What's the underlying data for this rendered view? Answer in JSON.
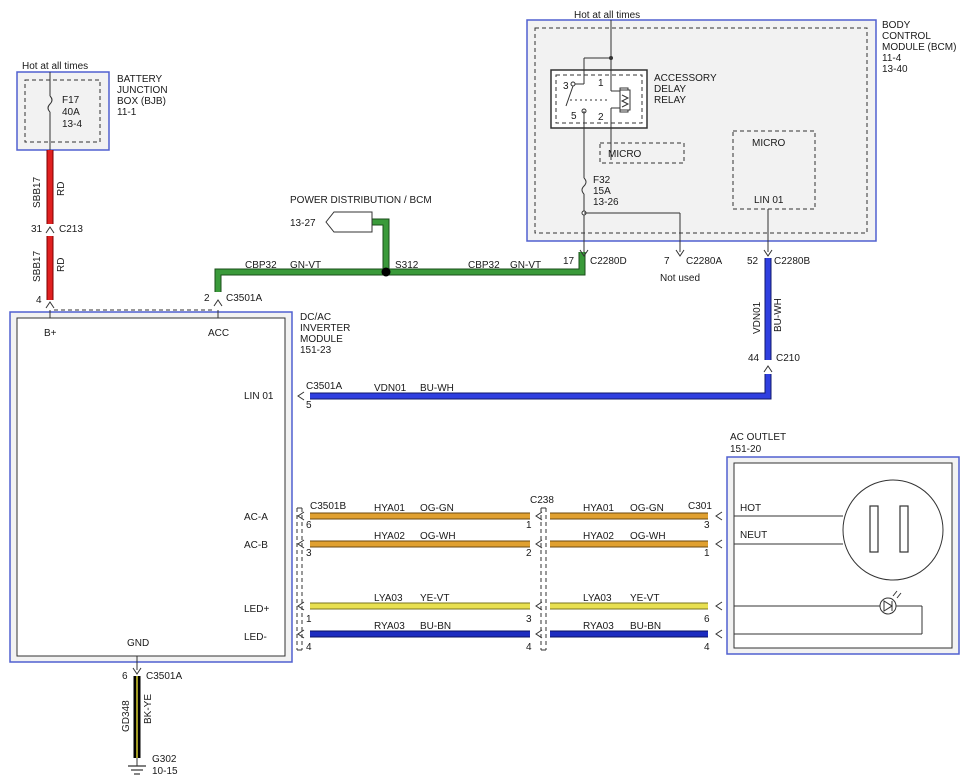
{
  "colors": {
    "red": "#e02020",
    "green": "#3a9a3a",
    "blue": "#2f3fe0",
    "orange": "#e0a030",
    "yellow": "#e8e050",
    "navy": "#1c2cc0",
    "black_yellow": "#2a2a10",
    "module_border": "#5060d0"
  },
  "hot_at_all_times": "Hot at all times",
  "bjb": {
    "name": "BATTERY JUNCTION BOX (BJB)",
    "line1": "BATTERY",
    "line2": "JUNCTION",
    "line3": "BOX (BJB)",
    "ref": "11-1",
    "fuse_id": "F17",
    "fuse_rating": "40A",
    "fuse_ref": "13-4"
  },
  "sbb17_wire": {
    "circuit": "SBB17",
    "color": "RD"
  },
  "c213": {
    "name": "C213",
    "pin": "31"
  },
  "inverter": {
    "line1": "DC/AC",
    "line2": "INVERTER",
    "line3": "MODULE",
    "ref": "151-23",
    "pin_bplus": "B+",
    "pin_acc": "ACC",
    "pin_lin": "LIN 01",
    "pin_aca": "AC-A",
    "pin_acb": "AC-B",
    "pin_ledp": "LED+",
    "pin_ledm": "LED-",
    "pin_gnd": "GND"
  },
  "power_dist": {
    "label": "POWER DISTRIBUTION / BCM",
    "ref": "13-27"
  },
  "cbp32": {
    "circuit": "CBP32",
    "color": "GN-VT"
  },
  "s312": "S312",
  "c3501a_acc": {
    "name": "C3501A",
    "pin": "2"
  },
  "bplus_pin": "4",
  "bcm": {
    "line1": "BODY",
    "line2": "CONTROL",
    "line3": "MODULE (BCM)",
    "ref1": "11-4",
    "ref2": "13-40",
    "relay_line1": "ACCESSORY",
    "relay_line2": "DELAY",
    "relay_line3": "RELAY",
    "relay_pin1": "1",
    "relay_pin2": "2",
    "relay_pin3": "3",
    "relay_pin5": "5",
    "micro": "MICRO",
    "micro2": "MICRO",
    "lin": "LIN 01",
    "fuse_id": "F32",
    "fuse_rating": "15A",
    "fuse_ref": "13-26"
  },
  "c2280d": {
    "name": "C2280D",
    "pin": "17"
  },
  "c2280a": {
    "name": "C2280A",
    "pin": "7",
    "note": "Not used"
  },
  "c2280b": {
    "name": "C2280B",
    "pin": "52"
  },
  "vdn01_vertical": {
    "circuit": "VDN01",
    "color": "BU-WH"
  },
  "c210": {
    "name": "C210",
    "pin": "44"
  },
  "lin_row": {
    "connector": "C3501A",
    "pin": "5",
    "circuit": "VDN01",
    "color": "BU-WH"
  },
  "ac_outlet": {
    "title": "AC OUTLET",
    "ref": "151-20",
    "hot": "HOT",
    "neut": "NEUT"
  },
  "c3501b": "C3501B",
  "c238": "C238",
  "c301": "C301",
  "hya01": {
    "circuit": "HYA01",
    "color": "OG-GN",
    "pin_left": "6",
    "pin_mid": "1",
    "pin_right": "3"
  },
  "hya02": {
    "circuit": "HYA02",
    "color": "OG-WH",
    "pin_left": "3",
    "pin_mid": "2",
    "pin_right": "1"
  },
  "lya03": {
    "circuit": "LYA03",
    "color": "YE-VT",
    "pin_left": "1",
    "pin_mid": "3",
    "pin_right": "6"
  },
  "rya03": {
    "circuit": "RYA03",
    "color": "BU-BN",
    "pin_left": "4",
    "pin_mid": "4",
    "pin_right": "4"
  },
  "gnd_conn": {
    "name": "C3501A",
    "pin": "6"
  },
  "gd348": {
    "circuit": "GD348",
    "color": "BK-YE"
  },
  "g302": {
    "name": "G302",
    "ref": "10-15"
  }
}
